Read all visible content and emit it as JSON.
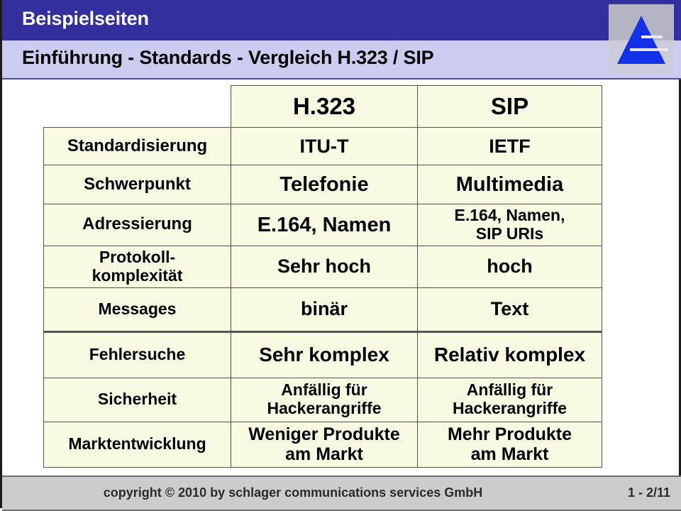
{
  "header": {
    "title": "Beispielseiten",
    "subtitle": "Einführung - Standards - Vergleich H.323 / SIP",
    "band_color": "#332f9e",
    "subband_color": "#ccccf0",
    "logo": {
      "name": "blue-triangle-logo",
      "color": "#1331e8"
    }
  },
  "table": {
    "columns": [
      "",
      "H.323",
      "SIP"
    ],
    "rows": [
      {
        "label": "Standardisierung",
        "h323": "ITU-T",
        "sip": "IETF"
      },
      {
        "label": "Schwerpunkt",
        "h323": "Telefonie",
        "sip": "Multimedia"
      },
      {
        "label": "Adressierung",
        "h323": "E.164, Namen",
        "sip": "E.164, Namen,\nSIP URIs"
      },
      {
        "label": "Protokoll-\nkomplexität",
        "h323": "Sehr hoch",
        "sip": "hoch"
      },
      {
        "label": "Messages",
        "h323": "binär",
        "sip": "Text"
      },
      {
        "label": "Fehlersuche",
        "h323": "Sehr komplex",
        "sip": "Relativ komplex"
      },
      {
        "label": "Sicherheit",
        "h323": "Anfällig für\nHackerangriffe",
        "sip": "Anfällig für\nHackerangriffe"
      },
      {
        "label": "Marktentwicklung",
        "h323": "Weniger Produkte\nam Markt",
        "sip": "Mehr Produkte\nam Markt"
      }
    ]
  },
  "footer": {
    "copyright": "copyright © 2010 by schlager communications services GmbH",
    "page": "1 - 2/11"
  }
}
